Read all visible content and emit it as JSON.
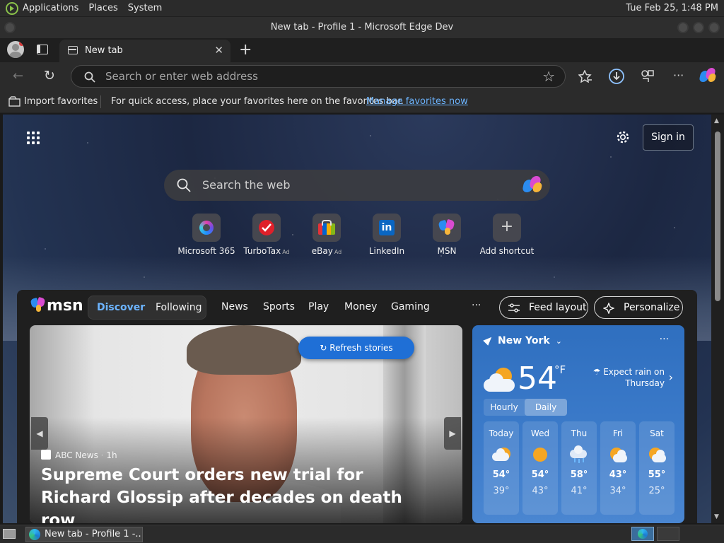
{
  "system_panel": {
    "menus": [
      "Applications",
      "Places",
      "System"
    ],
    "clock": "Tue Feb 25,  1:48 PM"
  },
  "window": {
    "title": "New tab - Profile 1 - Microsoft Edge Dev"
  },
  "tab": {
    "label": "New tab",
    "close": "✕",
    "new": "+"
  },
  "toolbar": {
    "back": "←",
    "refresh": "↻",
    "omnibox_placeholder": "Search or enter web address",
    "star": "☆",
    "more": "···"
  },
  "favorites_bar": {
    "import": "Import favorites",
    "hint": "For quick access, place your favorites here on the favorites bar.",
    "manage_link": "Manage favorites now"
  },
  "ntp": {
    "sign_in": "Sign in",
    "search_placeholder": "Search the web",
    "shortcuts": [
      {
        "label": "Microsoft 365",
        "ad": ""
      },
      {
        "label": "TurboTax",
        "ad": "Ad"
      },
      {
        "label": "eBay",
        "ad": "Ad"
      },
      {
        "label": "LinkedIn",
        "ad": ""
      },
      {
        "label": "MSN",
        "ad": ""
      },
      {
        "label": "Add shortcut",
        "ad": ""
      }
    ],
    "tile_glyphs": {
      "linkedin": "in",
      "add": "+"
    }
  },
  "feed": {
    "logo": "msn",
    "tabs": [
      "Discover",
      "Following"
    ],
    "nav": [
      "News",
      "Sports",
      "Play",
      "Money",
      "Gaming"
    ],
    "more": "···",
    "feed_layout": "Feed layout",
    "personalize": "Personalize",
    "hero": {
      "refresh": "Refresh stories",
      "source": "ABC News",
      "age": "1h",
      "headline": "Supreme Court orders new trial for Richard Glossip after decades on death row",
      "prev": "◀",
      "next": "▶"
    },
    "weather": {
      "city": "New York",
      "temp": "54",
      "unit": "°F",
      "forecast_note": "Expect rain on Thursday",
      "modes": [
        "Hourly",
        "Daily"
      ],
      "more": "···",
      "days": [
        {
          "name": "Today",
          "icon": "partly-cloudy",
          "hi": "54°",
          "lo": "39°"
        },
        {
          "name": "Wed",
          "icon": "sunny",
          "hi": "54°",
          "lo": "43°"
        },
        {
          "name": "Thu",
          "icon": "rain",
          "hi": "58°",
          "lo": "41°"
        },
        {
          "name": "Fri",
          "icon": "partly-sunny",
          "hi": "43°",
          "lo": "34°"
        },
        {
          "name": "Sat",
          "icon": "partly-sunny",
          "hi": "55°",
          "lo": "25°"
        }
      ]
    }
  },
  "taskbar": {
    "window_label": "New tab - Profile 1 -..."
  }
}
